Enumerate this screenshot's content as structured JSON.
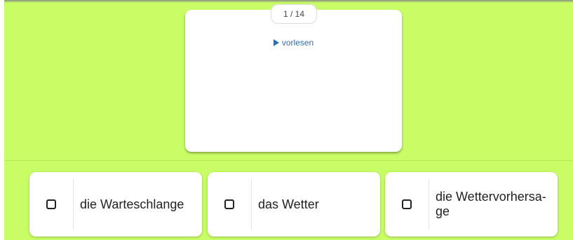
{
  "card": {
    "counter": "1 / 14",
    "read_aloud_label": "vorlesen"
  },
  "options": [
    {
      "label": "die Warteschlange"
    },
    {
      "label": "das Wetter"
    },
    {
      "label": "die Wettervorhersa-\nge"
    }
  ],
  "colors": {
    "background": "#c8fd66",
    "link": "#2f6fb2"
  }
}
